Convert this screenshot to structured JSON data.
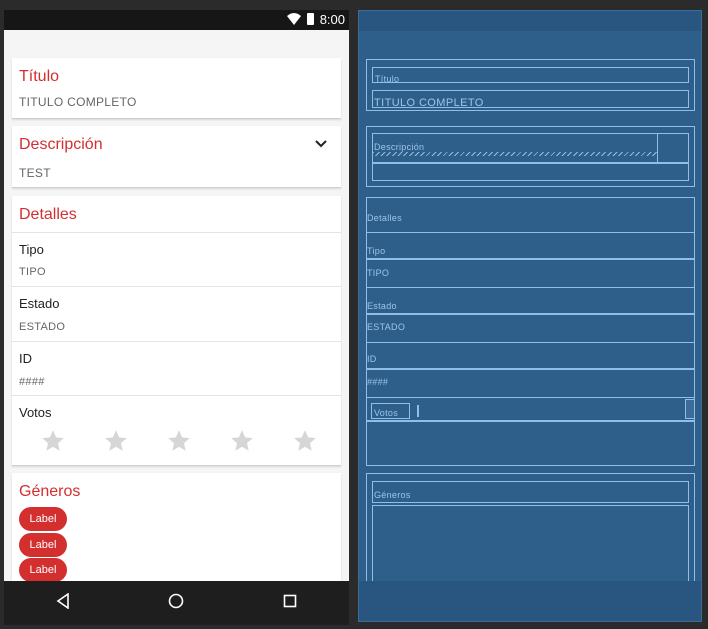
{
  "status_bar": {
    "time": "8:00"
  },
  "titulo": {
    "heading": "Título",
    "value": "TITULO COMPLETO"
  },
  "descripcion": {
    "heading": "Descripción",
    "value": "TEST"
  },
  "detalles": {
    "heading": "Detalles",
    "fields": [
      {
        "label": "Tipo",
        "value": "TIPO"
      },
      {
        "label": "Estado",
        "value": "ESTADO"
      },
      {
        "label": "ID",
        "value": "####"
      }
    ],
    "votos_label": "Votos",
    "rating": {
      "value": 0,
      "max": 5
    }
  },
  "generos": {
    "heading": "Géneros",
    "chips": [
      "Label",
      "Label",
      "Label"
    ]
  },
  "colors": {
    "accent": "#d32f2f",
    "blueprint_bg": "#2e5e8a",
    "blueprint_line": "#8fbfe8"
  },
  "icons": {
    "chevron": "chevron-down-icon",
    "star": "star-icon",
    "back": "back-triangle-icon",
    "home": "home-circle-icon",
    "recents": "recents-square-icon"
  }
}
